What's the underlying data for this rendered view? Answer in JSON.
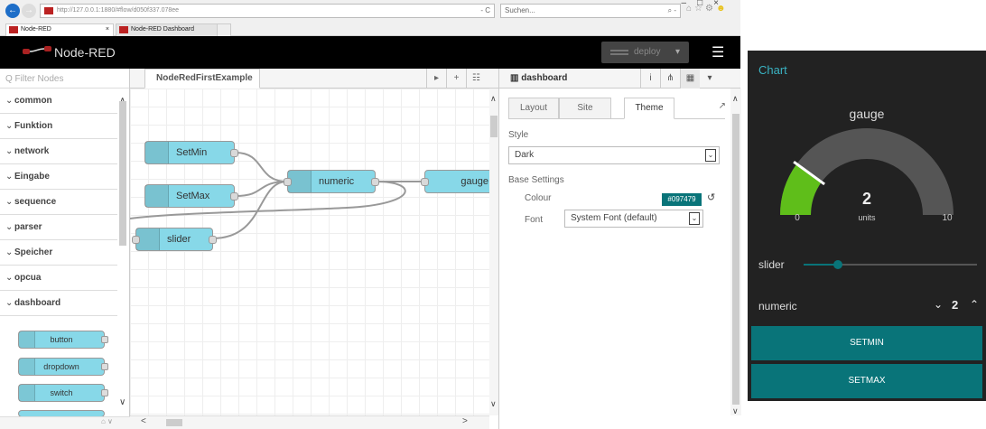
{
  "browser": {
    "url": "http://127.0.0.1:1880/#flow/d050f337.078ee",
    "search_placeholder": "Suchen...",
    "nav_icons": [
      "back-arrow-icon",
      "forward-arrow-icon"
    ],
    "tabs": [
      {
        "label": "Node-RED"
      },
      {
        "label": "Node-RED Dashboard"
      }
    ],
    "tab_close": "×",
    "window_controls": [
      "–",
      "□",
      "×"
    ],
    "refresh_label": "- C",
    "search_glyph": "⌕ -",
    "tool_glyphs": "⌂☆⚙",
    "smiley": "☻"
  },
  "nodered": {
    "title": "Node-RED",
    "deploy_label": "deploy",
    "deploy_caret": "▾",
    "menu_glyph": "☰",
    "filter_placeholder": "Q Filter Nodes",
    "categories": [
      "common",
      "Funktion",
      "network",
      "Eingabe",
      "sequence",
      "parser",
      "Speicher",
      "opcua",
      "dashboard"
    ],
    "chev_glyph": "⌄",
    "palette_nodes": [
      "button",
      "dropdown",
      "switch"
    ],
    "palette_scroll_up": "∧",
    "palette_scroll_down": "∨",
    "palette_footer": "⌂ ∨",
    "flow_tab": "NodeRedFirstExample",
    "workspace_buttons": [
      "▸",
      "+",
      "☷"
    ],
    "flow_nodes": {
      "setmin": "SetMin",
      "setmax": "SetMax",
      "numeric": "numeric",
      "gauge": "gauge",
      "slider": "slider"
    },
    "canvas_scroll_up": "∧",
    "canvas_scroll_down": "∨",
    "hscroll_left": "<",
    "hscroll_right": ">",
    "zoom_controls": "▭ – ○ +"
  },
  "sidebar": {
    "title": "dashboard",
    "header_buttons": [
      "i",
      "⋔",
      "▦",
      "▾"
    ],
    "tabs": [
      "Layout",
      "Site",
      "Theme"
    ],
    "active_tab": "Theme",
    "ext_glyph": "↗",
    "style_label": "Style",
    "style_value": "Dark",
    "base_settings_label": "Base Settings",
    "colour_label": "Colour",
    "colour_value": "#097479",
    "reset_glyph": "↺",
    "font_label": "Font",
    "font_value": "System Font (default)",
    "select_arrow": "⌄",
    "scroll_up": "∧",
    "scroll_down": "∨"
  },
  "dashboard": {
    "title": "Chart",
    "gauge": {
      "label": "gauge",
      "value": "2",
      "units": "units",
      "min": "0",
      "max": "10",
      "value_num": 2,
      "max_num": 10
    },
    "slider_label": "slider",
    "slider_value_fraction": 0.2,
    "numeric_label": "numeric",
    "numeric_value": "2",
    "numeric_down": "⌄",
    "numeric_up": "⌃",
    "buttons": [
      "SETMIN",
      "SETMAX"
    ]
  },
  "colors": {
    "node_blue": "#87d8e8",
    "dash_accent": "#097479",
    "gauge_fill": "#5fbe1a",
    "gauge_track": "#555555"
  }
}
